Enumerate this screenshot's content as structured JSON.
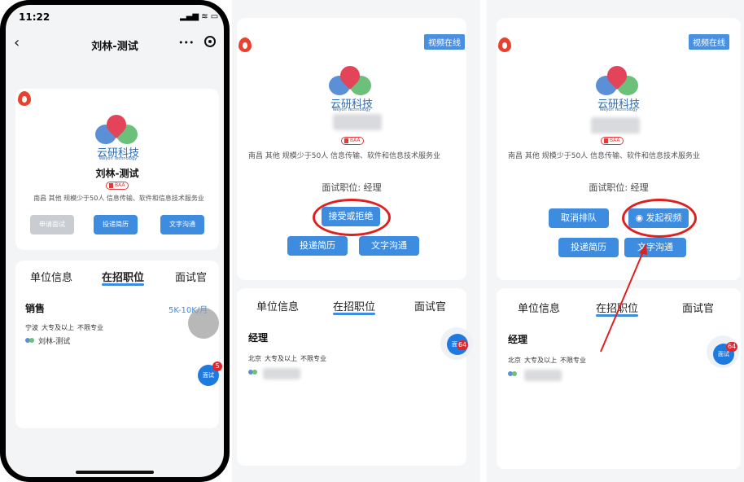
{
  "panel1": {
    "status_time": "11:22",
    "nav_title": "刘林-测试",
    "nav_more": "•••",
    "company_name": "刘林-测试",
    "logo_cn": "云研科技",
    "logo_en": "Weyon Technology",
    "badge": "BAA",
    "company_info": "南昌  其他  规模少于50人  信息传输、软件和信息技术服务业",
    "buttons": {
      "apply": "申请面试",
      "resume": "投递简历",
      "chat": "文字沟通"
    },
    "tabs": [
      "单位信息",
      "在招职位",
      "面试官"
    ],
    "job": {
      "title": "销售",
      "salary": "5K-10K/月",
      "tags": [
        "宁波",
        "大专及以上",
        "不限专业"
      ],
      "company": "刘林-测试"
    },
    "fab_label": "面试",
    "fab_count": "5"
  },
  "panel2": {
    "video_tag": "视频在线",
    "logo_cn": "云研科技",
    "logo_en": "Weyon Technology",
    "badge": "BAA",
    "company_info": "南昌  其他  规模少于50人  信息传输、软件和信息技术服务业",
    "position_line": "面试职位: 经理",
    "buttons": {
      "accept": "接受或拒绝",
      "resume": "投递简历",
      "chat": "文字沟通"
    },
    "tabs": [
      "单位信息",
      "在招职位",
      "面试官"
    ],
    "job": {
      "title": "经理",
      "tags": [
        "北京",
        "大专及以上",
        "不限专业"
      ]
    },
    "fab_label": "面试",
    "fab_count": "64"
  },
  "panel3": {
    "video_tag": "视频在线",
    "logo_cn": "云研科技",
    "logo_en": "Weyon Technology",
    "badge": "BAA",
    "company_info": "南昌  其他  规模少于50人  信息传输、软件和信息技术服务业",
    "position_line": "面试职位: 经理",
    "buttons": {
      "cancel": "取消排队",
      "video": "发起视频",
      "resume": "投递简历",
      "chat": "文字沟通"
    },
    "tabs": [
      "单位信息",
      "在招职位",
      "面试官"
    ],
    "job": {
      "title": "经理",
      "tags": [
        "北京",
        "大专及以上",
        "不限专业"
      ]
    },
    "fab_label": "面试",
    "fab_count": "64"
  },
  "colors": {
    "accent": "#3d8ce0",
    "highlight_ring": "#e0201e",
    "badge": "#e3262b"
  }
}
